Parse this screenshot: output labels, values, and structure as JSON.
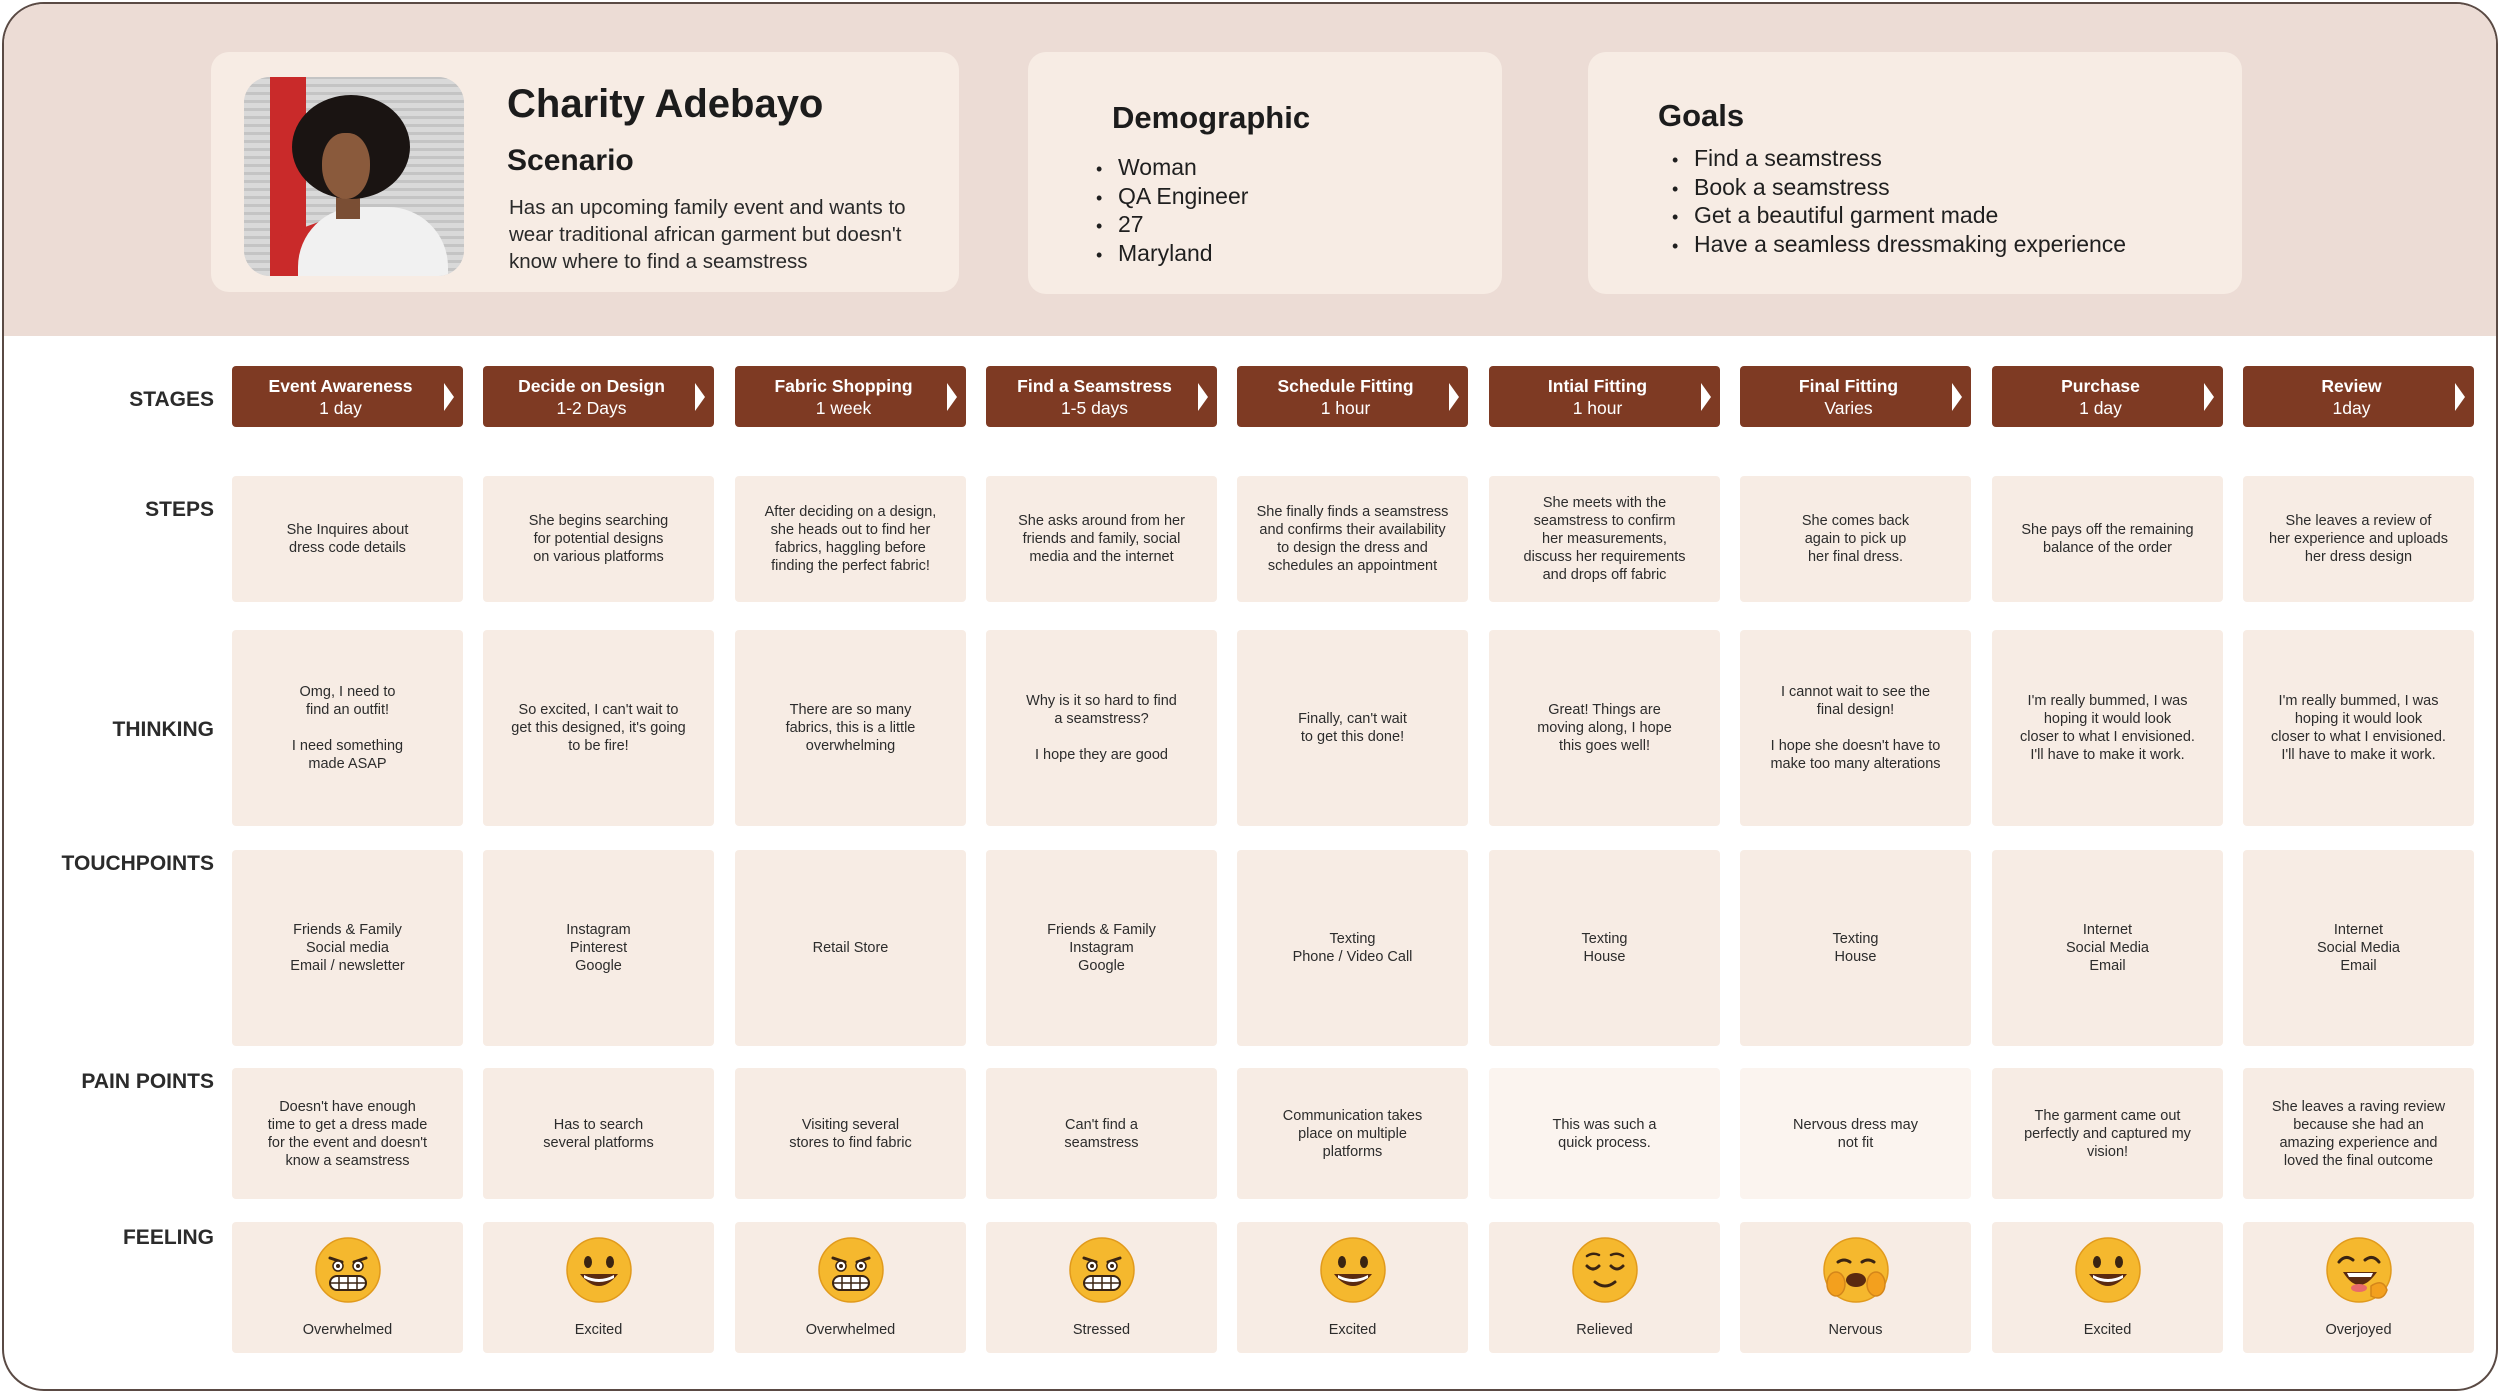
{
  "persona": {
    "name": "Charity Adebayo",
    "scenario_heading": "Scenario",
    "scenario_text": "Has an upcoming family event and wants to wear traditional african garment but doesn't know where to find a seamstress"
  },
  "demographic": {
    "title": "Demographic",
    "items": [
      "Woman",
      "QA Engineer",
      "27",
      "Maryland"
    ]
  },
  "goals": {
    "title": "Goals",
    "items": [
      "Find a seamstress",
      "Book a seamstress",
      "Get a beautiful garment made",
      "Have a seamless dressmaking experience"
    ]
  },
  "row_labels": {
    "stages": "STAGES",
    "steps": "STEPS",
    "thinking": "THINKING",
    "touchpoints": "TOUCHPOINTS",
    "pain_points": "PAIN POINTS",
    "feeling": "FEELING"
  },
  "stages": [
    {
      "name": "Event Awareness",
      "duration": "1 day"
    },
    {
      "name": "Decide on Design",
      "duration": "1-2 Days"
    },
    {
      "name": "Fabric Shopping",
      "duration": "1 week"
    },
    {
      "name": "Find a Seamstress",
      "duration": "1-5 days"
    },
    {
      "name": "Schedule Fitting",
      "duration": "1 hour"
    },
    {
      "name": "Intial Fitting",
      "duration": "1 hour"
    },
    {
      "name": "Final Fitting",
      "duration": "Varies"
    },
    {
      "name": "Purchase",
      "duration": "1 day"
    },
    {
      "name": "Review",
      "duration": "1day"
    }
  ],
  "steps": [
    "She Inquires about\ndress code details",
    "She begins searching\nfor potential designs\non various platforms",
    "After deciding on a design,\nshe heads out to find her\nfabrics, haggling before\nfinding the perfect fabric!",
    "She asks around from her\nfriends and family, social\nmedia and the internet",
    "She finally finds a seamstress\nand confirms their availability\nto design the dress and\nschedules an appointment",
    "She meets with the\nseamstress to confirm\nher measurements,\ndiscuss her requirements\nand drops off fabric",
    "She comes back\nagain to pick up\nher final dress.",
    "She pays off the remaining\nbalance of the order",
    "She leaves a review of\nher experience and uploads\nher dress design"
  ],
  "thinking": [
    "Omg, I need to\nfind an outfit!\n\nI need something\nmade ASAP",
    "So excited, I can't wait to\nget this designed, it's going\nto be fire!",
    "There are so many\nfabrics, this is a little\noverwhelming",
    "Why is it so hard to find\na seamstress?\n\nI hope they are good",
    "Finally, can't wait\nto get this done!",
    "Great! Things are\nmoving along, I hope\nthis goes well!",
    "I cannot wait to see the\nfinal design!\n\nI hope she doesn't have to\nmake too many alterations",
    "I'm really bummed, I was\nhoping it would look\ncloser to what I envisioned.\nI'll have to make it work.",
    "I'm really bummed, I was\nhoping it would look\ncloser to what I envisioned.\nI'll have to make it work."
  ],
  "touchpoints": [
    "Friends & Family\nSocial media\nEmail / newsletter",
    "Instagram\nPinterest\nGoogle",
    "Retail Store",
    "Friends & Family\nInstagram\nGoogle",
    "Texting\nPhone / Video Call",
    "Texting\nHouse",
    "Texting\nHouse",
    "Internet\nSocial Media\nEmail",
    "Internet\nSocial Media\nEmail"
  ],
  "pain_points": [
    "Doesn't have enough\ntime to get a dress made\nfor the event and doesn't\nknow a seamstress",
    "Has to search\nseveral platforms",
    "Visiting several\nstores to find fabric",
    "Can't find a\nseamstress",
    "Communication takes\nplace on multiple\nplatforms",
    "This was such a\nquick process.",
    "Nervous dress may\nnot fit",
    "The garment came out\nperfectly and captured my\nvision!",
    "She leaves a raving review\nbecause she had an\namazing experience and\nloved the final outcome"
  ],
  "feelings": [
    {
      "label": "Overwhelmed",
      "icon": "grimacing-face-icon"
    },
    {
      "label": "Excited",
      "icon": "grinning-face-icon"
    },
    {
      "label": "Overwhelmed",
      "icon": "grimacing-face-icon"
    },
    {
      "label": "Stressed",
      "icon": "grimacing-face-icon"
    },
    {
      "label": "Excited",
      "icon": "grinning-face-icon"
    },
    {
      "label": "Relieved",
      "icon": "relieved-face-icon"
    },
    {
      "label": "Nervous",
      "icon": "anxious-face-icon"
    },
    {
      "label": "Excited",
      "icon": "grinning-face-icon"
    },
    {
      "label": "Overjoyed",
      "icon": "laughing-face-icon"
    }
  ],
  "colors": {
    "header_bg": "#ecdcd5",
    "card_bg": "#f7ece4",
    "stage_bg": "#7e3a23",
    "emoji_yellow": "#f5b82e"
  }
}
